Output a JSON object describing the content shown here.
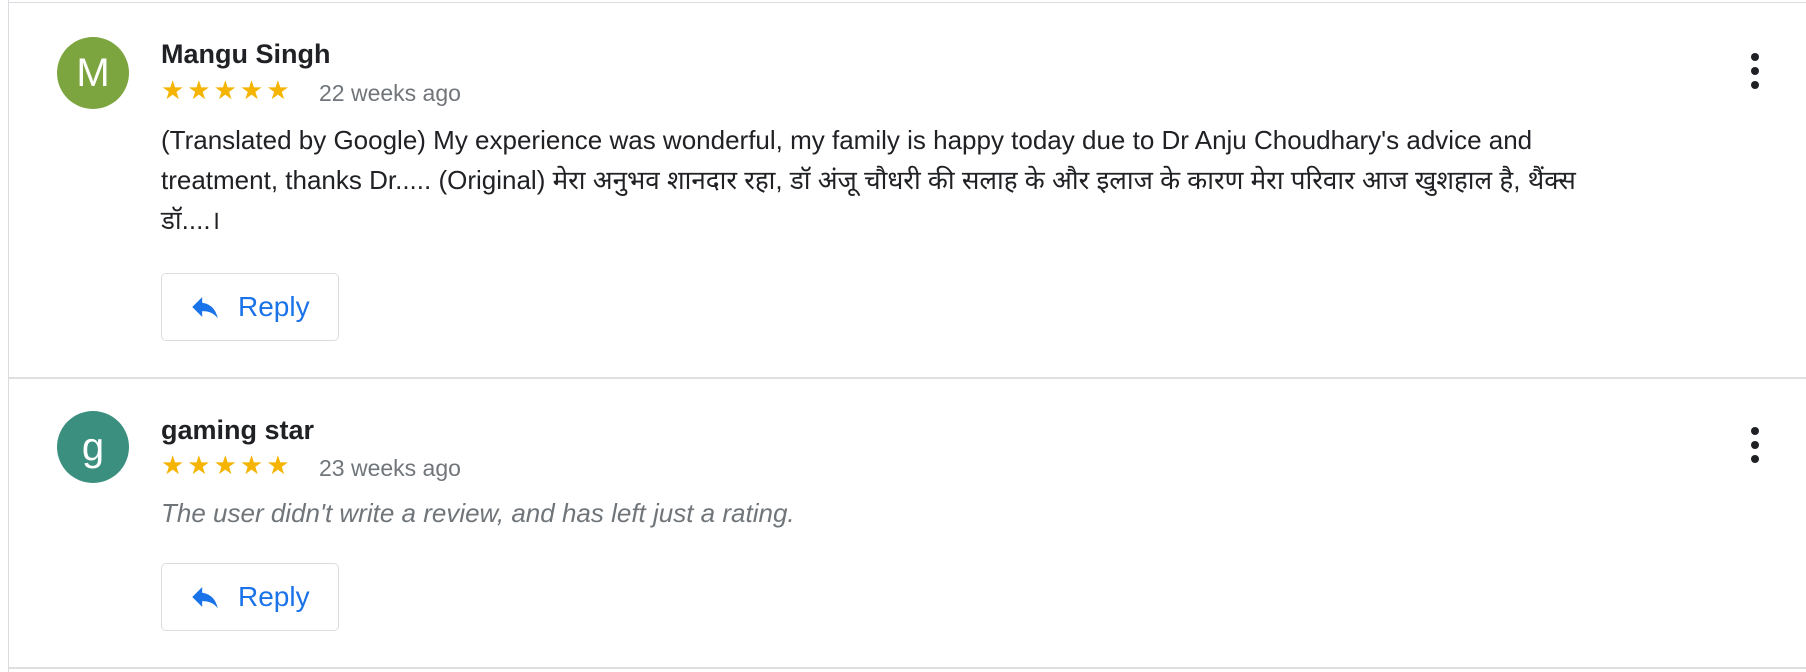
{
  "reviews": [
    {
      "avatar_letter": "M",
      "avatar_color": "#7ca43f",
      "name": "Mangu Singh",
      "stars": "★★★★★",
      "time": "22 weeks ago",
      "text": "(Translated by Google) My experience was wonderful, my family is happy today due to Dr Anju Choudhary's advice and treatment, thanks Dr..... (Original) मेरा अनुभव शानदार रहा, डॉ अंजू चौधरी की सलाह के और इलाज के कारण मेरा परिवार आज खुशहाल है, थैंक्स डॉ....।",
      "reply_label": "Reply"
    },
    {
      "avatar_letter": "g",
      "avatar_color": "#3b8f7f",
      "name": "gaming star",
      "stars": "★★★★★",
      "time": "23 weeks ago",
      "text": "The user didn't write a review, and has left just a rating.",
      "reply_label": "Reply"
    }
  ]
}
